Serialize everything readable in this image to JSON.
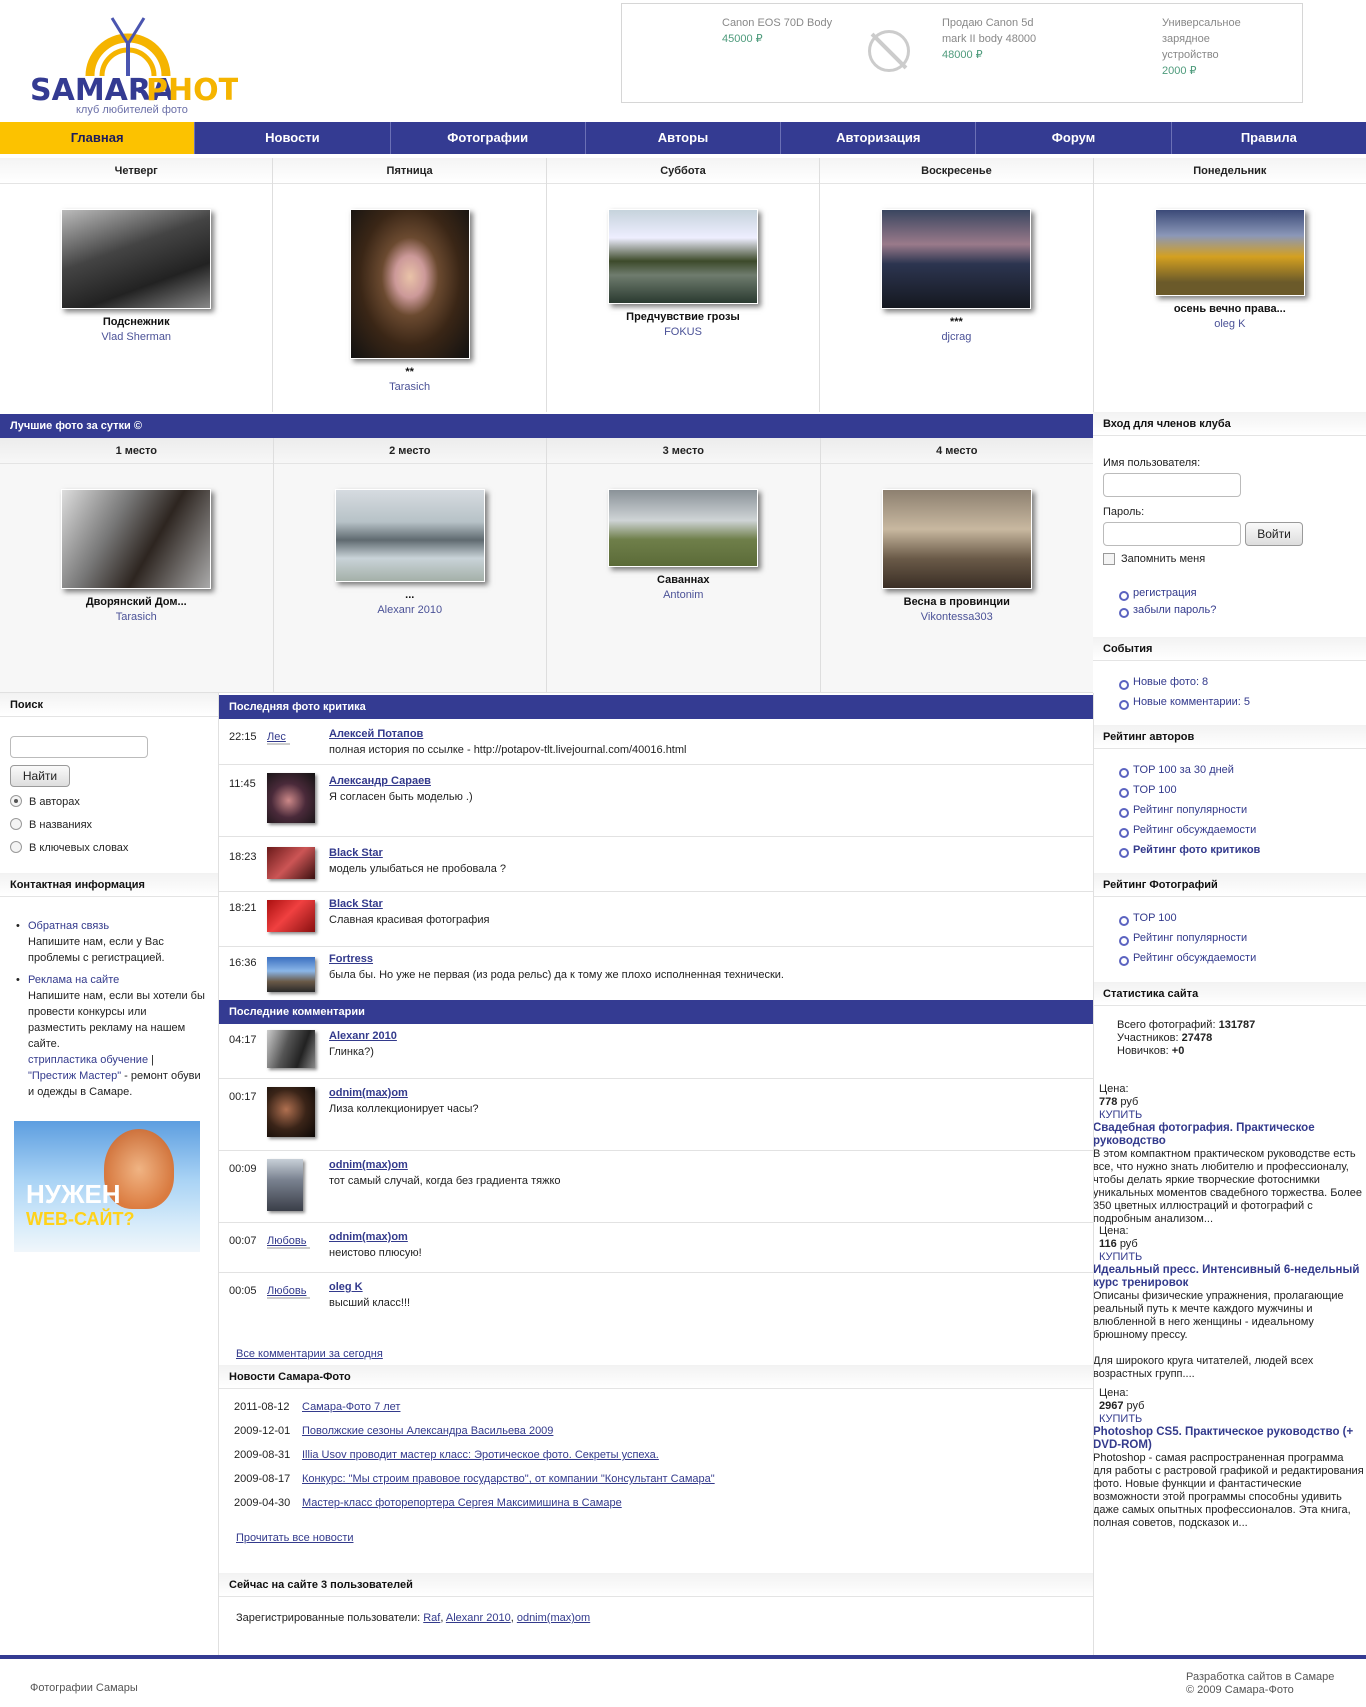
{
  "header": {
    "logo_text": "SAMARA·PHOTO",
    "logo_subtitle": "клуб любителей фото",
    "ads": [
      {
        "title": "Canon EOS 70D Body",
        "price": "45000 ₽"
      },
      {
        "title": "Продаю Canon 5d mark II body 48000",
        "title_line1": "Продаю Canon 5d",
        "title_line2": "mark II body 48000",
        "price": "48000 ₽"
      },
      {
        "title_line1": "Универсальное",
        "title_line2": "зарядное",
        "title_line3": "устройство",
        "price": "2000 ₽"
      }
    ]
  },
  "nav": [
    "Главная",
    "Новости",
    "Фотографии",
    "Авторы",
    "Авторизация",
    "Форум",
    "Правила"
  ],
  "days": [
    {
      "day": "Четверг",
      "title": "Подснежник",
      "author": "Vlad Sherman"
    },
    {
      "day": "Пятница",
      "title": "**",
      "author": "Tarasich"
    },
    {
      "day": "Суббота",
      "title": "Предчувствие грозы",
      "author": "FOKUS"
    },
    {
      "day": "Воскресенье",
      "title": "***",
      "author": "djcrag"
    },
    {
      "day": "Понедельник",
      "title": "осень вечно права...",
      "author": "oleg K"
    }
  ],
  "best": {
    "heading": "Лучшие фото за сутки ©",
    "places": [
      {
        "place": "1 место",
        "title": "Дворянский Дом...",
        "author": "Tarasich"
      },
      {
        "place": "2 место",
        "title": "...",
        "author": "Alexanr 2010"
      },
      {
        "place": "3 место",
        "title": "Саваннах",
        "author": "Antonim"
      },
      {
        "place": "4 место",
        "title": "Весна в провинции",
        "author": "Vikontessa303"
      }
    ]
  },
  "login": {
    "heading": "Вход для членов клуба",
    "username_label": "Имя пользователя:",
    "password_label": "Пароль:",
    "submit": "Войти",
    "remember": "Запомнить меня",
    "links": [
      "регистрация",
      "забыли пароль?"
    ]
  },
  "events": {
    "heading": "События",
    "items": [
      "Новые фото: 8",
      "Новые комментарии: 5"
    ]
  },
  "author_rating": {
    "heading": "Рейтинг авторов",
    "items": [
      "TOP 100 за 30 дней",
      "TOP 100",
      "Рейтинг популярности",
      "Рейтинг обсуждаемости",
      "Рейтинг фото критиков"
    ]
  },
  "photo_rating": {
    "heading": "Рейтинг Фотографий",
    "items": [
      "TOP 100",
      "Рейтинг популярности",
      "Рейтинг обсуждаемости"
    ]
  },
  "stats": {
    "heading": "Статистика сайта",
    "photos_label": "Всего фотографий:",
    "photos": "131787",
    "members_label": "Участников:",
    "members": "27478",
    "newbies_label": "Новичков:",
    "newbies": "+0"
  },
  "books": [
    {
      "price_label": "Цена:",
      "price": "778",
      "currency": "руб",
      "buy": "КУПИТЬ",
      "title": "Свадебная фотография. Практическое руководство",
      "desc": "В этом компактном практическом руководстве есть все, что нужно знать любителю и профессионалу, чтобы делать яркие творческие фотоснимки уникальных моментов свадебного торжества. Более 350 цветных иллюстраций и фотографий с подробным анализом..."
    },
    {
      "price_label": "Цена:",
      "price": "116",
      "currency": "руб",
      "buy": "КУПИТЬ",
      "title": "Идеальный пресс. Интенсивный 6-недельный курс тренировок",
      "desc": "Описаны физические упражнения, пролагающие реальный путь к мечте каждого мужчины и влюбленной в него женщины - идеальному брюшному прессу.",
      "desc2": "Для широкого круга читателей, людей всех возрастных групп...."
    },
    {
      "price_label": "Цена:",
      "price": "2967",
      "currency": "руб",
      "buy": "КУПИТЬ",
      "title": "Photoshop CS5. Практическое руководство (+ DVD-ROM)",
      "desc": "Photoshop - самая распространенная программа для работы с растровой графикой и редактирования фото. Новые функции и фантастические возможности этой программы способны удивить даже самых опытных профессионалов. Эта книга, полная советов, подсказок и..."
    }
  ],
  "search": {
    "heading": "Поиск",
    "button": "Найти",
    "options": [
      "В авторах",
      "В названиях",
      "В ключевых словах"
    ]
  },
  "contacts": {
    "heading": "Контактная информация",
    "feedback_link": "Обратная связь",
    "feedback_text": "Напишите нам, если у Вас проблемы с регистрацией.",
    "ads_link": "Реклама на сайте",
    "ads_text": "Напишите нам, если вы хотели бы провести конкурсы или разместить рекламу на нашем сайте.",
    "extra_link1": "стрипластика обучение",
    "sep": "|",
    "extra_link2": "\"Престиж Мастер\"",
    "extra_text": "- ремонт обуви и одежды в Самаре."
  },
  "banner": {
    "line1": "НУЖЕН",
    "line2": "WEB-САЙТ?"
  },
  "critique": {
    "heading": "Последняя фото критика",
    "items": [
      {
        "time": "22:15",
        "tag": "Лес",
        "name": "Алексей Потапов",
        "text": "полная история по ссылке - http://potapov-tlt.livejournal.com/40016.html"
      },
      {
        "time": "11:45",
        "name": "Александр Сараев",
        "text": "Я согласен быть моделью .)"
      },
      {
        "time": "18:23",
        "name": "Black Star",
        "text": "модель улыбаться не пробовала ?"
      },
      {
        "time": "18:21",
        "name": "Black Star",
        "text": "Славная красивая фотография"
      },
      {
        "time": "16:36",
        "name": "Fortress",
        "text": "была бы. Но уже не первая (из рода рельс) да к тому же плохо исполненная технически."
      }
    ]
  },
  "comments": {
    "heading": "Последние комментарии",
    "items": [
      {
        "time": "04:17",
        "name": "Alexanr 2010",
        "text": "Глинка?)"
      },
      {
        "time": "00:17",
        "name": "odnim(max)om",
        "text": "Лиза коллекционирует часы?"
      },
      {
        "time": "00:09",
        "name": "odnim(max)om",
        "text": "тот самый случай, когда без градиента тяжко"
      },
      {
        "time": "00:07",
        "tag": "Любовь",
        "name": "odnim(max)om",
        "text": "неистово плюсую!"
      },
      {
        "time": "00:05",
        "tag": "Любовь",
        "name": "oleg K",
        "text": "высший класс!!!"
      }
    ],
    "all_link": "Все комментарии за сегодня"
  },
  "news": {
    "heading": "Новости Самара-Фото",
    "items": [
      {
        "date": "2011-08-12",
        "title": "Самара-Фото 7 лет"
      },
      {
        "date": "2009-12-01",
        "title": "Поволжские сезоны Александра Васильева 2009"
      },
      {
        "date": "2009-08-31",
        "title": "Illia Usov проводит мастер класс: Эротическое фото. Секреты успеха."
      },
      {
        "date": "2009-08-17",
        "title": "Конкурс: \"Мы строим правовое государство\", от компании \"Консультант Самара\""
      },
      {
        "date": "2009-04-30",
        "title": "Мастер-класс фоторепортера Сергея Максимишина в Самаре"
      }
    ],
    "all_link": "Прочитать все новости"
  },
  "online": {
    "heading": "Сейчас на сайте 3 пользователей",
    "label": "Зарегистрированные пользователи:",
    "users": [
      "Raf",
      "Alexanr 2010",
      "odnim(max)om"
    ]
  },
  "footer": {
    "left": "Фотографии Самары",
    "dev": "Разработка сайтов в Самаре",
    "copyright": "© 2009 Самара-Фото"
  },
  "colors": {
    "nav": "#343b92",
    "active": "#fcc200",
    "link": "#333a8c",
    "price": "#4e9b7c"
  }
}
